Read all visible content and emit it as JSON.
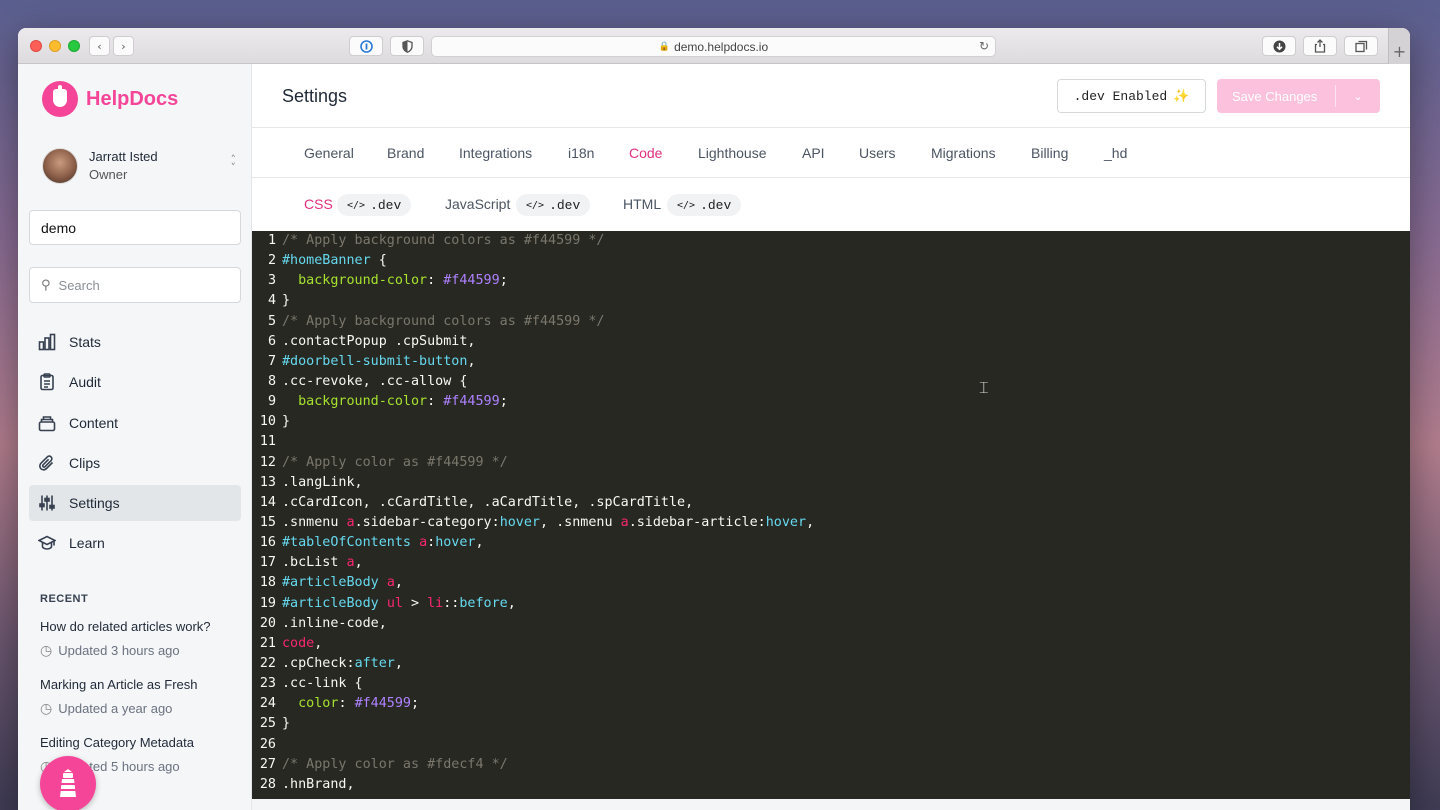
{
  "browser": {
    "url": "demo.helpdocs.io"
  },
  "sidebar": {
    "brand": "HelpDocs",
    "user": {
      "name": "Jarratt Isted",
      "role": "Owner"
    },
    "site": "demo",
    "search_placeholder": "Search",
    "nav": [
      {
        "label": "Stats",
        "icon": "bar-chart-icon"
      },
      {
        "label": "Audit",
        "icon": "clipboard-icon"
      },
      {
        "label": "Content",
        "icon": "stack-icon"
      },
      {
        "label": "Clips",
        "icon": "paperclip-icon"
      },
      {
        "label": "Settings",
        "icon": "sliders-icon",
        "active": true
      },
      {
        "label": "Learn",
        "icon": "graduation-cap-icon"
      }
    ],
    "recent_title": "RECENT",
    "recent": [
      {
        "title": "How do related articles work?",
        "updated": "Updated 3 hours ago"
      },
      {
        "title": "Marking an Article as Fresh",
        "updated": "Updated a year ago"
      },
      {
        "title": "Editing Category Metadata",
        "updated": "Updated 5 hours ago"
      }
    ]
  },
  "header": {
    "title": "Settings",
    "dev_label": ".dev Enabled",
    "save_label": "Save Changes"
  },
  "tabs": [
    "General",
    "Brand",
    "Integrations",
    "i18n",
    "Code",
    "Lighthouse",
    "API",
    "Users",
    "Migrations",
    "Billing",
    "_hd"
  ],
  "active_tab": "Code",
  "subtabs": [
    {
      "label": "CSS",
      "pill": ".dev",
      "active": true
    },
    {
      "label": "JavaScript",
      "pill": ".dev"
    },
    {
      "label": "HTML",
      "pill": ".dev"
    }
  ],
  "code": [
    [
      [
        "c-comment",
        "/* Apply background colors as #f44599 */"
      ]
    ],
    [
      [
        "c-id",
        "#homeBanner"
      ],
      [
        "c-text",
        " {"
      ]
    ],
    [
      [
        "c-text",
        "  "
      ],
      [
        "c-prop",
        "background-color"
      ],
      [
        "c-text",
        ": "
      ],
      [
        "c-val",
        "#f44599"
      ],
      [
        "c-text",
        ";"
      ]
    ],
    [
      [
        "c-text",
        "}"
      ]
    ],
    [
      [
        "c-comment",
        "/* Apply background colors as #f44599 */"
      ]
    ],
    [
      [
        "c-text",
        ".contactPopup .cpSubmit,"
      ]
    ],
    [
      [
        "c-id",
        "#doorbell-submit-button"
      ],
      [
        "c-text",
        ","
      ]
    ],
    [
      [
        "c-text",
        ".cc-revoke, .cc-allow {"
      ]
    ],
    [
      [
        "c-text",
        "  "
      ],
      [
        "c-prop",
        "background-color"
      ],
      [
        "c-text",
        ": "
      ],
      [
        "c-val",
        "#f44599"
      ],
      [
        "c-text",
        ";"
      ]
    ],
    [
      [
        "c-text",
        "}"
      ]
    ],
    [],
    [
      [
        "c-comment",
        "/* Apply color as #f44599 */"
      ]
    ],
    [
      [
        "c-text",
        ".langLink,"
      ]
    ],
    [
      [
        "c-text",
        ".cCardIcon, .cCardTitle, .aCardTitle, .spCardTitle,"
      ]
    ],
    [
      [
        "c-text",
        ".snmenu "
      ],
      [
        "c-tag",
        "a"
      ],
      [
        "c-text",
        ".sidebar-category:"
      ],
      [
        "c-id",
        "hover"
      ],
      [
        "c-text",
        ", .snmenu "
      ],
      [
        "c-tag",
        "a"
      ],
      [
        "c-text",
        ".sidebar-article:"
      ],
      [
        "c-id",
        "hover"
      ],
      [
        "c-text",
        ","
      ]
    ],
    [
      [
        "c-id",
        "#tableOfContents"
      ],
      [
        "c-text",
        " "
      ],
      [
        "c-tag",
        "a"
      ],
      [
        "c-text",
        ":"
      ],
      [
        "c-id",
        "hover"
      ],
      [
        "c-text",
        ","
      ]
    ],
    [
      [
        "c-text",
        ".bcList "
      ],
      [
        "c-tag",
        "a"
      ],
      [
        "c-text",
        ","
      ]
    ],
    [
      [
        "c-id",
        "#articleBody"
      ],
      [
        "c-text",
        " "
      ],
      [
        "c-tag",
        "a"
      ],
      [
        "c-text",
        ","
      ]
    ],
    [
      [
        "c-id",
        "#articleBody"
      ],
      [
        "c-text",
        " "
      ],
      [
        "c-tag",
        "ul"
      ],
      [
        "c-text",
        " > "
      ],
      [
        "c-tag",
        "li"
      ],
      [
        "c-text",
        "::"
      ],
      [
        "c-id",
        "before"
      ],
      [
        "c-text",
        ","
      ]
    ],
    [
      [
        "c-text",
        ".inline-code,"
      ]
    ],
    [
      [
        "c-tag",
        "code"
      ],
      [
        "c-text",
        ","
      ]
    ],
    [
      [
        "c-text",
        ".cpCheck:"
      ],
      [
        "c-id",
        "after"
      ],
      [
        "c-text",
        ","
      ]
    ],
    [
      [
        "c-text",
        ".cc-link {"
      ]
    ],
    [
      [
        "c-text",
        "  "
      ],
      [
        "c-prop",
        "color"
      ],
      [
        "c-text",
        ": "
      ],
      [
        "c-val",
        "#f44599"
      ],
      [
        "c-text",
        ";"
      ]
    ],
    [
      [
        "c-text",
        "}"
      ]
    ],
    [],
    [
      [
        "c-comment",
        "/* Apply color as #fdecf4 */"
      ]
    ],
    [
      [
        "c-text",
        ".hnBrand,"
      ]
    ]
  ],
  "colors": {
    "brand": "#f44599",
    "editor_bg": "#272822"
  }
}
